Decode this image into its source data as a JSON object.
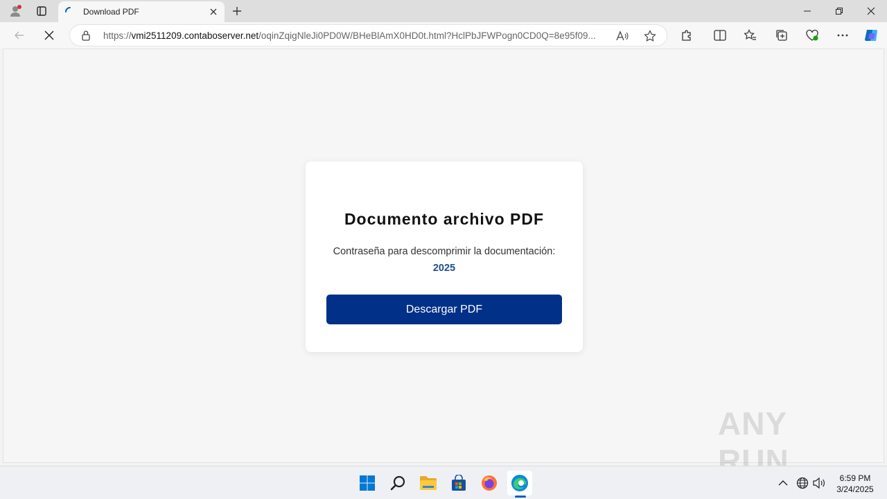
{
  "tab": {
    "title": "Download PDF"
  },
  "address": {
    "prefix": "https://",
    "host": "vmi2511209.contaboserver.net",
    "path": "/oqinZqigNleJi0PD0W/BHeBlAmX0HD0t.html?HclPbJFWPogn0CD0Q=8e95f09..."
  },
  "card": {
    "title": "Documento archivo PDF",
    "text": "Contraseña para descomprimir la documentación:",
    "password": "2025",
    "button": "Descargar PDF"
  },
  "watermark": "ANY RUN",
  "clock": {
    "time": "6:59 PM",
    "date": "3/24/2025"
  },
  "colors": {
    "button": "#003087",
    "password": "#1f4e8c",
    "accent": "#005fb8"
  }
}
